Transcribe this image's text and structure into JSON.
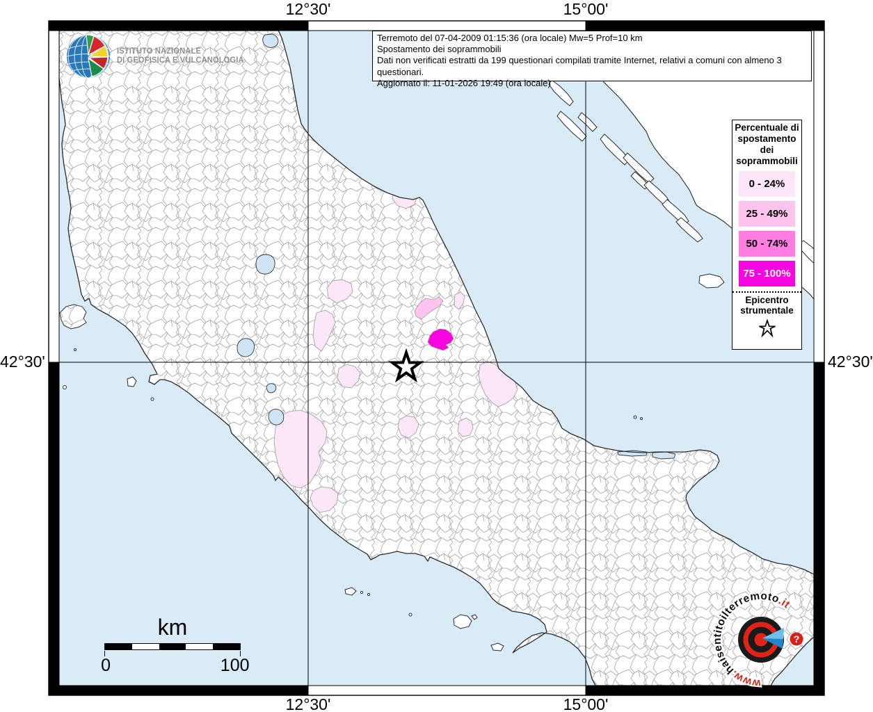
{
  "title_box": {
    "line1": "Terremoto del 07-04-2009 01:15:36 (ora locale) Mw=5 Prof=10 km",
    "line2": "Spostamento dei soprammobili",
    "line3": "Dati non verificati estratti da 199 questionari compilati tramite Internet, relativi a comuni con almeno 3 questionari.",
    "line4": "Aggiornato il: 11-01-2026 19:49 (ora locale)"
  },
  "ingv_logo": {
    "line1": "ISTITUTO NAZIONALE",
    "line2": "DI GEOFISICA E VULCANOLOGIA"
  },
  "legend": {
    "title": "Percentuale di spostamento dei soprammobili",
    "classes": [
      {
        "label": "0 - 24%",
        "color": "#fce6f8",
        "text_color": "#000000"
      },
      {
        "label": "25 - 49%",
        "color": "#ffc3ef",
        "text_color": "#000000"
      },
      {
        "label": "50 - 74%",
        "color": "#ff7ee0",
        "text_color": "#000000"
      },
      {
        "label": "75 - 100%",
        "color": "#f505e0",
        "text_color": "#ffffff"
      }
    ],
    "epicenter_label": "Epicentro strumentale"
  },
  "graticule": {
    "top_left_lon": "12°30'",
    "top_right_lon": "15°00'",
    "bottom_left_lon": "12°30'",
    "bottom_right_lon": "15°00'",
    "left_lat": "42°30'",
    "right_lat": "42°30'"
  },
  "scale_bar": {
    "unit": "km",
    "start": "0",
    "end": "100"
  },
  "watermark": {
    "prefix": "www.",
    "middle": "haisentitoilterremoto",
    "suffix": ".it",
    "question_mark": "?"
  },
  "map_colors": {
    "sea": "#d9ebf7",
    "land": "#ffffff",
    "municipality_border": "#a5a5a5",
    "coastline": "#2b2b2b",
    "epicenter_star_fill": "#ffffff",
    "epicenter_star_stroke": "#000000"
  }
}
